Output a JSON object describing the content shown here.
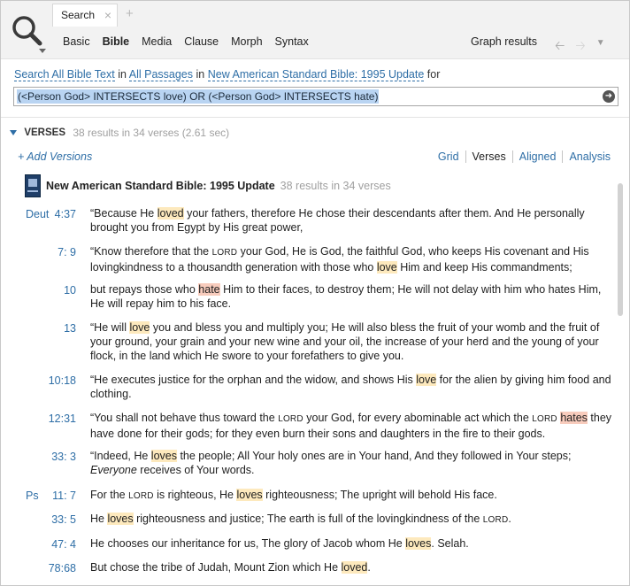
{
  "tabs": {
    "active_label": "Search",
    "close_glyph": "×",
    "add_glyph": "+"
  },
  "modes": [
    "Basic",
    "Bible",
    "Media",
    "Clause",
    "Morph",
    "Syntax"
  ],
  "active_mode": "Bible",
  "toolbar": {
    "graph_results": "Graph results",
    "back_icon": "arrow-left",
    "forward_icon": "arrow-right",
    "menu_icon": "chevron-down"
  },
  "scope": {
    "search_link": "Search All Bible Text",
    "in1": "in",
    "passages_link": "All Passages",
    "in2": "in",
    "version_link": "New American Standard Bible: 1995 Update",
    "for_text": "for"
  },
  "query": {
    "value": "(<Person God> INTERSECTS love) OR (<Person God> INTERSECTS hate)"
  },
  "results": {
    "section_title": "VERSES",
    "summary": "38 results in 34 verses (2.61 sec)",
    "add_versions": "+ Add Versions",
    "views": [
      "Grid",
      "Verses",
      "Aligned",
      "Analysis"
    ],
    "active_view": "Verses",
    "version_title": "New American Standard Bible: 1995 Update",
    "version_summary": "38 results in 34 verses"
  },
  "colors": {
    "link": "#2e6ea6",
    "love_highlight": "#fde9bd",
    "hate_highlight": "#f8ccbd",
    "query_selection": "#b9d4f2"
  },
  "verses": [
    {
      "book": "Deut",
      "ref": "4:37",
      "segments": [
        {
          "t": "“Because He "
        },
        {
          "t": "loved",
          "h": "love"
        },
        {
          "t": " your fathers, therefore He chose their descendants after them. And He personally brought you from Egypt by His great power,"
        }
      ]
    },
    {
      "book": "",
      "ref": "7: 9",
      "segments": [
        {
          "t": "“Know therefore that the "
        },
        {
          "t": "Lord",
          "h": "sc"
        },
        {
          "t": " your God, He is God, the faithful God, who keeps His covenant and His lovingkindness to a thousandth generation with those who "
        },
        {
          "t": "love",
          "h": "love"
        },
        {
          "t": " Him and keep His commandments;"
        }
      ]
    },
    {
      "book": "",
      "ref": "10",
      "segments": [
        {
          "t": "but repays those who "
        },
        {
          "t": "hate",
          "h": "hate"
        },
        {
          "t": " Him to their faces, to destroy them; He will not delay with him who hates Him, He will repay him to his face."
        }
      ]
    },
    {
      "book": "",
      "ref": "13",
      "segments": [
        {
          "t": "“He will "
        },
        {
          "t": "love",
          "h": "love"
        },
        {
          "t": " you and bless you and multiply you; He will also bless the fruit of your womb and the fruit of your ground, your grain and your new wine and your oil, the increase of your herd and the young of your flock, in the land which He swore to your forefathers to give you."
        }
      ]
    },
    {
      "book": "",
      "ref": "10:18",
      "segments": [
        {
          "t": "“He executes justice for the orphan and the widow, and shows His "
        },
        {
          "t": "love",
          "h": "love"
        },
        {
          "t": " for the alien by giving him food and clothing."
        }
      ]
    },
    {
      "book": "",
      "ref": "12:31",
      "segments": [
        {
          "t": "“You shall not behave thus toward the "
        },
        {
          "t": "Lord",
          "h": "sc"
        },
        {
          "t": " your God, for every abominable act which the "
        },
        {
          "t": "Lord",
          "h": "sc"
        },
        {
          "t": " "
        },
        {
          "t": "hates",
          "h": "hate"
        },
        {
          "t": " they have done for their gods; for they even burn their sons and daughters in the fire to their gods."
        }
      ]
    },
    {
      "book": "",
      "ref": "33: 3",
      "segments": [
        {
          "t": "“Indeed, He "
        },
        {
          "t": "loves",
          "h": "love"
        },
        {
          "t": " the people; All Your holy ones are in Your hand, And they followed in Your steps; "
        },
        {
          "t": "Everyone",
          "h": "it"
        },
        {
          "t": " receives of Your words."
        }
      ]
    },
    {
      "book": "Ps",
      "ref": "11: 7",
      "segments": [
        {
          "t": "For the "
        },
        {
          "t": "Lord",
          "h": "sc"
        },
        {
          "t": " is righteous, He "
        },
        {
          "t": "loves",
          "h": "love"
        },
        {
          "t": " righteousness; The upright will behold His face."
        }
      ]
    },
    {
      "book": "",
      "ref": "33: 5",
      "segments": [
        {
          "t": "He "
        },
        {
          "t": "loves",
          "h": "love"
        },
        {
          "t": " righteousness and justice; The earth is full of the lovingkindness of the "
        },
        {
          "t": "Lord",
          "h": "sc"
        },
        {
          "t": "."
        }
      ]
    },
    {
      "book": "",
      "ref": "47: 4",
      "segments": [
        {
          "t": "He chooses our inheritance for us, The glory of Jacob whom He "
        },
        {
          "t": "loves",
          "h": "love"
        },
        {
          "t": ". Selah."
        }
      ]
    },
    {
      "book": "",
      "ref": "78:68",
      "segments": [
        {
          "t": "But chose the tribe of Judah, Mount Zion which He "
        },
        {
          "t": "loved",
          "h": "love"
        },
        {
          "t": "."
        }
      ]
    }
  ]
}
